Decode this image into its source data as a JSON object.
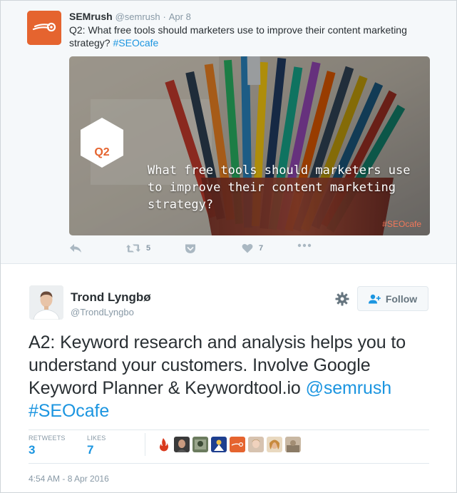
{
  "quoted_tweet": {
    "name": "SEMrush",
    "handle": "@semrush",
    "separator": "·",
    "time": "Apr 8",
    "text": "Q2: What free tools should marketers use to improve their content marketing strategy? ",
    "hashtag": "#SEOcafe",
    "media": {
      "badge": "Q2",
      "caption": "What free tools should marketers use to improve their content marketing strategy?",
      "tag": "#SEOcafe"
    },
    "actions": {
      "reply_icon": "reply-icon",
      "retweet_icon": "retweet-icon",
      "retweet_count": "5",
      "pocket_icon": "pocket-icon",
      "like_icon": "heart-icon",
      "like_count": "7",
      "more_icon": "more-icon"
    }
  },
  "tweet": {
    "author_name": "Trond Lyngbø",
    "author_handle": "@TrondLyngbo",
    "follow_label": "Follow",
    "text_main": "A2: Keyword research and analysis helps you to understand your customers. Involve Google Keyword Planner & Keywordtool.io ",
    "mention": "@semrush",
    "hashtag": "#SEOcafe",
    "stats": {
      "retweets_label": "RETWEETS",
      "retweets_value": "3",
      "likes_label": "LIKES",
      "likes_value": "7"
    },
    "timestamp": "4:54 AM - 8 Apr 2016"
  },
  "colors": {
    "brand_orange": "#e5642f",
    "link_blue": "#1b95e0",
    "muted_gray": "#8899a6"
  }
}
